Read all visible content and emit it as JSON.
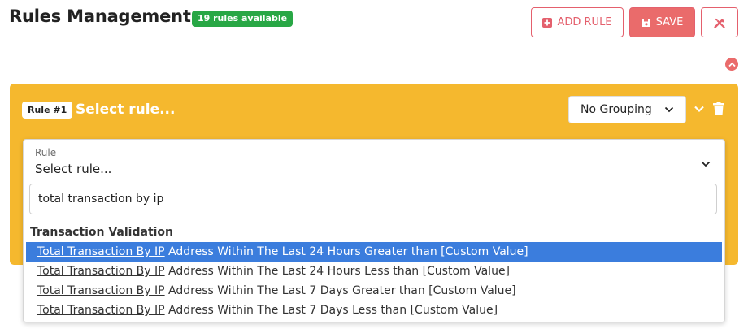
{
  "header": {
    "title": "Rules Management",
    "rules_count_badge": "19 rules available",
    "add_rule_label": "ADD RULE",
    "save_label": "SAVE"
  },
  "rule_card": {
    "tag": "Rule #1",
    "heading": "Select rule...",
    "grouping": {
      "selected": "No Grouping"
    },
    "rule_field": {
      "label": "Rule",
      "value": "Select rule..."
    },
    "search": {
      "value": "total transaction by ip"
    },
    "group_name": "Transaction Validation",
    "options": [
      {
        "match": "Total Transaction By IP",
        "rest": " Address Within The Last 24 Hours Greater than [Custom Value]",
        "highlighted": true
      },
      {
        "match": "Total Transaction By IP",
        "rest": " Address Within The Last 24 Hours Less than [Custom Value]",
        "highlighted": false
      },
      {
        "match": "Total Transaction By IP",
        "rest": " Address Within The Last 7 Days Greater than [Custom Value]",
        "highlighted": false
      },
      {
        "match": "Total Transaction By IP",
        "rest": " Address Within The Last 7 Days Less than [Custom Value]",
        "highlighted": false
      }
    ]
  },
  "icons": {
    "add": "plus-square-icon",
    "save": "floppy-disk-icon",
    "tools": "tools-icon",
    "collapse": "chevron-up-circle-icon",
    "expand": "chevron-down-icon",
    "delete": "trash-icon",
    "select_chevron": "chevron-down-icon"
  },
  "colors": {
    "accent": "#ea6b6b",
    "badge_green": "#28a745",
    "rule_panel": "#f5b82e",
    "option_highlight": "#3b7ddd"
  }
}
